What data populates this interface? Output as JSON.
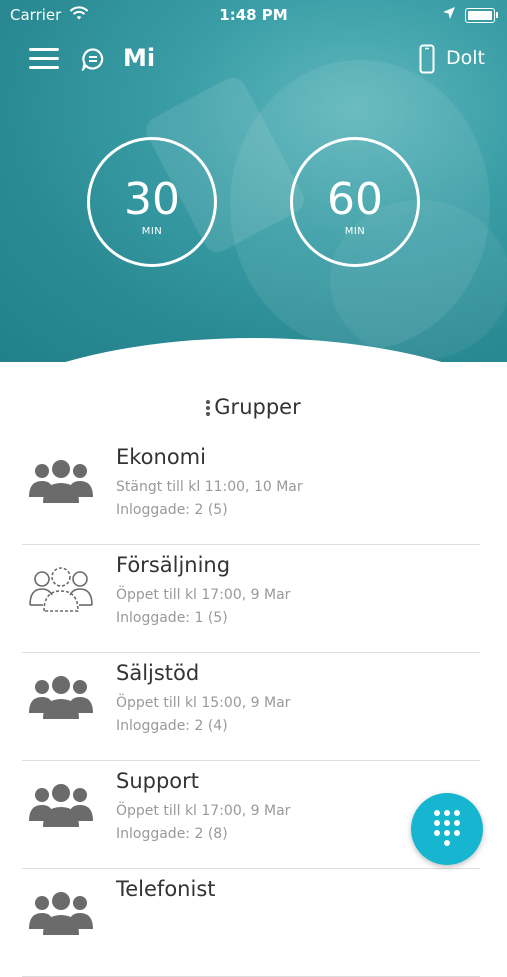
{
  "statusbar": {
    "carrier": "Carrier",
    "time": "1:48 PM"
  },
  "nav": {
    "title": "Mi",
    "mode": "Dolt"
  },
  "timers": [
    {
      "value": "30",
      "unit": "MIN"
    },
    {
      "value": "60",
      "unit": "MIN"
    }
  ],
  "groups_title": "Grupper",
  "groups": [
    {
      "name": "Ekonomi",
      "status": "Stängt till kl 11:00, 10 Mar",
      "logged": "Inloggade: 2 (5)",
      "icon": "group-icon"
    },
    {
      "name": "Försäljning",
      "status": "Öppet till kl 17:00, 9 Mar",
      "logged": "Inloggade: 1 (5)",
      "icon": "group-outline-icon"
    },
    {
      "name": "Säljstöd",
      "status": "Öppet till kl 15:00, 9 Mar",
      "logged": "Inloggade: 2 (4)",
      "icon": "group-icon"
    },
    {
      "name": "Support",
      "status": "Öppet till kl 17:00, 9 Mar",
      "logged": "Inloggade: 2 (8)",
      "icon": "group-icon"
    },
    {
      "name": "Telefonist",
      "status": "",
      "logged": "",
      "icon": "group-icon"
    }
  ],
  "colors": {
    "accent": "#16b5d0",
    "hero": "#2a8a93"
  }
}
